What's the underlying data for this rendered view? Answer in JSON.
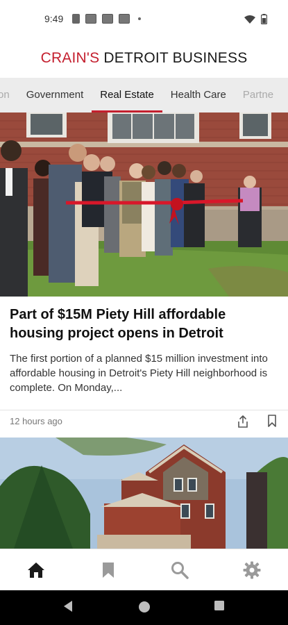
{
  "status_bar": {
    "time": "9:49"
  },
  "brand": {
    "part1": "CRAIN'S",
    "part2": " DETROIT BUSINESS"
  },
  "tabs": [
    {
      "label": "inion",
      "state": "partial"
    },
    {
      "label": "Government",
      "state": "normal"
    },
    {
      "label": "Real Estate",
      "state": "active"
    },
    {
      "label": "Health Care",
      "state": "normal"
    },
    {
      "label": "Partne",
      "state": "partial"
    }
  ],
  "article": {
    "headline": "Part of $15M Piety Hill affordable housing project opens in Detroit",
    "summary": "The first portion of a planned $15 million investment into affordable housing in Detroit's Piety Hill neighborhood is complete. On Monday,...",
    "time_ago": "12 hours ago"
  },
  "bottom_nav": {
    "items": [
      {
        "icon": "home-icon",
        "active": true
      },
      {
        "icon": "bookmark-icon",
        "active": false
      },
      {
        "icon": "search-icon",
        "active": false
      },
      {
        "icon": "gear-icon",
        "active": false
      }
    ]
  },
  "colors": {
    "brand_red": "#c41f2e",
    "tab_bg": "#ececec",
    "nav_active": "#1a1a1a",
    "nav_inactive": "#9a9a9a"
  }
}
